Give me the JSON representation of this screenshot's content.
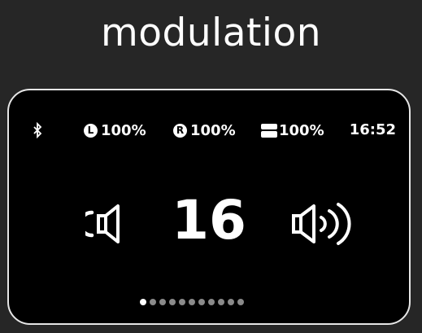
{
  "header": {
    "title": "modulation"
  },
  "status": {
    "bluetooth_icon": "bluetooth-icon",
    "left": {
      "badge": "L",
      "value": "100%"
    },
    "right": {
      "badge": "R",
      "value": "100%"
    },
    "case": {
      "icon": "charging-case-icon",
      "value": "100%"
    },
    "time": "16:52"
  },
  "volume": {
    "value": "16",
    "down_icon": "volume-down-icon",
    "up_icon": "volume-up-icon"
  },
  "pager": {
    "total": 11,
    "active": 1
  },
  "colors": {
    "background": "#262626",
    "screen": "#000000",
    "foreground": "#ffffff"
  }
}
